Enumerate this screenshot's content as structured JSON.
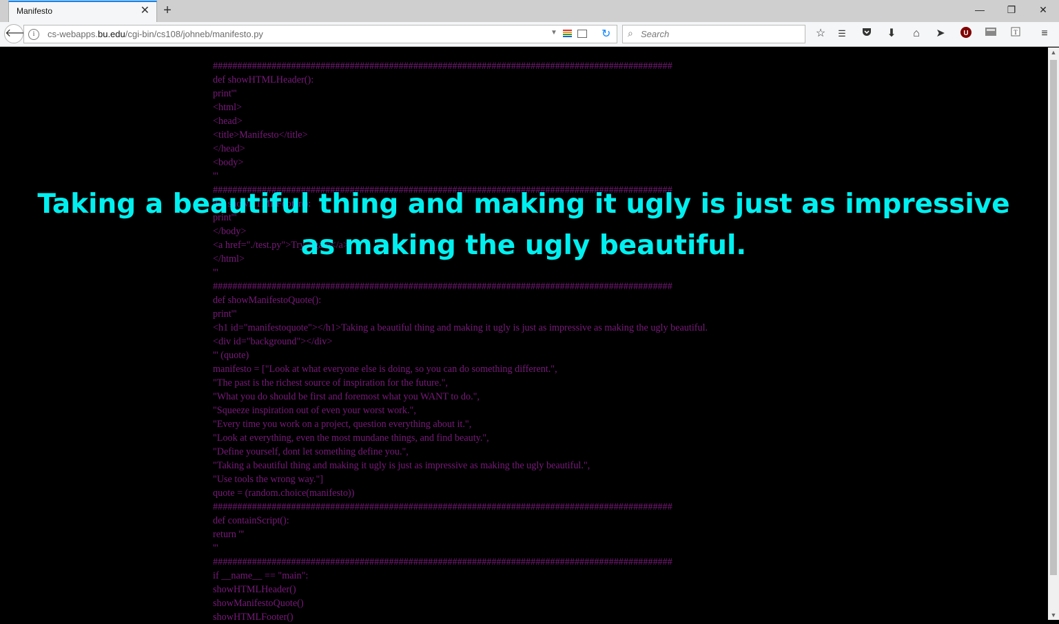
{
  "browser": {
    "tab": {
      "title": "Manifesto",
      "close": "✕"
    },
    "new_tab": "+",
    "window": {
      "minimize": "—",
      "restore": "❐",
      "close": "✕"
    },
    "url": {
      "prefix": "cs-webapps.",
      "domain": "bu.edu",
      "path": "/cgi-bin/cs108/johneb/manifesto.py"
    },
    "search": {
      "placeholder": "Search"
    },
    "icons": {
      "back": "back-arrow-icon",
      "info": "info-icon",
      "reload": "reload-icon",
      "toolbar": [
        "bookmark-star-icon",
        "reading-list-icon",
        "pocket-icon",
        "download-icon",
        "home-icon",
        "send-icon",
        "ublock-icon",
        "css-viewer-icon",
        "translate-icon",
        "hamburger-menu-icon"
      ]
    },
    "colors": {
      "accent": "#0a84ff",
      "ublock": "#800000"
    }
  },
  "page": {
    "background": "#000000",
    "code_color": "#7a1a7c",
    "quote_color": "#00f0f0",
    "quote": "Taking a beautiful thing and making it ugly is just as impressive as making the ugly beautiful.",
    "code_lines": [
      "##############################################################################################",
      "def showHTMLHeader():",
      "print'''",
      "<html>",
      "<head>",
      "<title>Manifesto</title>",
      "</head>",
      "<body>",
      "'''",
      "##############################################################################################",
      "def showHTMLFooter():",
      "print'''",
      "</body>",
      "<a href=\"./test.py\">Try Again</a>",
      "</html>",
      "'''",
      "##############################################################################################",
      "def showManifestoQuote():",
      "print'''",
      "<h1 id=\"manifestoquote\"></h1>Taking a beautiful thing and making it ugly is just as impressive as making the ugly beautiful.",
      "<div id=\"background\"></div>",
      "''' (quote)",
      "manifesto = [\"Look at what everyone else is doing, so you can do something different.\",",
      "\"The past is the richest source of inspiration for the future.\",",
      "\"What you do should be first and foremost what you WANT to do.\",",
      "\"Squeeze inspiration out of even your worst work.\",",
      "\"Every time you work on a project, question everything about it.\",",
      "\"Look at everything, even the most mundane things, and find beauty.\",",
      "\"Define yourself, dont let something define you.\",",
      "\"Taking a beautiful thing and making it ugly is just as impressive as making the ugly beautiful.\",",
      "\"Use tools the wrong way.\"]",
      "quote = (random.choice(manifesto))",
      "##############################################################################################",
      "def containScript():",
      "return '''",
      "'''",
      "##############################################################################################",
      "if __name__ == \"main\":",
      "showHTMLHeader()",
      "showManifestoQuote()",
      "showHTMLFooter()"
    ]
  }
}
